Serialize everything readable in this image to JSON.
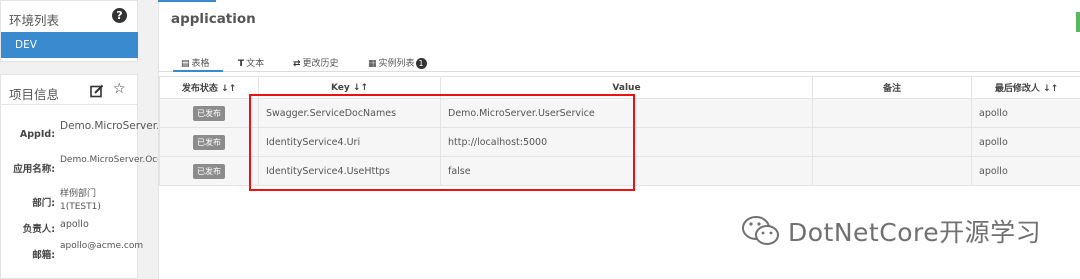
{
  "sidebar": {
    "env_list_title": "环境列表",
    "help_icon_glyph": "?",
    "envs": [
      {
        "label": "DEV"
      }
    ],
    "project_info_title": "项目信息",
    "fields": {
      "appid": {
        "label": "AppId:",
        "value": "Demo.MicroServer.Ocelot"
      },
      "app_name": {
        "label": "应用名称:",
        "value": "Demo.MicroServer.Ocelot"
      },
      "dept": {
        "label": "部门:",
        "value": "样例部门1(TEST1)"
      },
      "owner": {
        "label": "负责人:",
        "value": "apollo"
      },
      "email": {
        "label": "邮箱:",
        "value": "apollo@acme.com"
      }
    }
  },
  "namespace": {
    "title": "application",
    "tabs": [
      {
        "icon": "table-icon",
        "label": "表格"
      },
      {
        "icon": "text-icon",
        "label": "文本"
      },
      {
        "icon": "history-icon",
        "label": "更改历史"
      },
      {
        "icon": "instances-icon",
        "label": "实例列表",
        "badge": "1"
      }
    ],
    "columns": [
      "发布状态",
      "Key",
      "Value",
      "备注",
      "最后修改人"
    ],
    "rows": [
      {
        "status": "已发布",
        "key": "Swagger.ServiceDocNames",
        "value": "Demo.MicroServer.UserService",
        "comment": "",
        "modifier": "apollo"
      },
      {
        "status": "已发布",
        "key": "IdentityService4.Uri",
        "value": "http://localhost:5000",
        "comment": "",
        "modifier": "apollo"
      },
      {
        "status": "已发布",
        "key": "IdentityService4.UseHttps",
        "value": "false",
        "comment": "",
        "modifier": "apollo"
      }
    ]
  },
  "watermark": {
    "text": "DotNetCore开源学习"
  },
  "colors": {
    "accent": "#3a8ad0",
    "highlight": "#e11111",
    "published_badge": "#8c8c8c"
  }
}
